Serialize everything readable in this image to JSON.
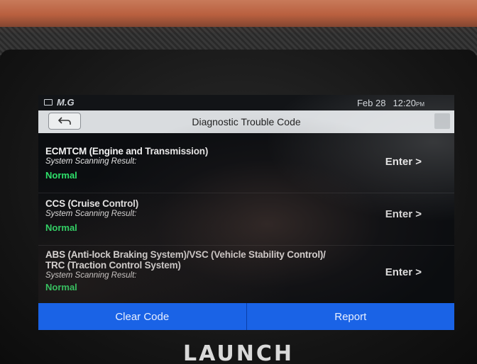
{
  "device": {
    "brand": "LAUNCH"
  },
  "status_bar": {
    "signal_text": "M.G",
    "date": "Feb 28",
    "time": "12:20",
    "ampm": "PM"
  },
  "header": {
    "title": "Diagnostic Trouble Code"
  },
  "systems": [
    {
      "name": "ECMTCM (Engine and Transmission)",
      "result_label": "System Scanning Result:",
      "status": "Normal",
      "action": "Enter >"
    },
    {
      "name": "CCS (Cruise Control)",
      "result_label": "System Scanning Result:",
      "status": "Normal",
      "action": "Enter >"
    },
    {
      "name_line1": "ABS (Anti-lock Braking System)/VSC (Vehicle Stability Control)/",
      "name_line2": "TRC (Traction Control System)",
      "result_label": "System Scanning Result:",
      "status": "Normal",
      "action": "Enter >"
    }
  ],
  "footer": {
    "clear_code": "Clear Code",
    "report": "Report"
  },
  "colors": {
    "status_normal": "#2ee06a",
    "footer_bar": "#1a63e6",
    "title_bar": "#d9dcdf"
  }
}
